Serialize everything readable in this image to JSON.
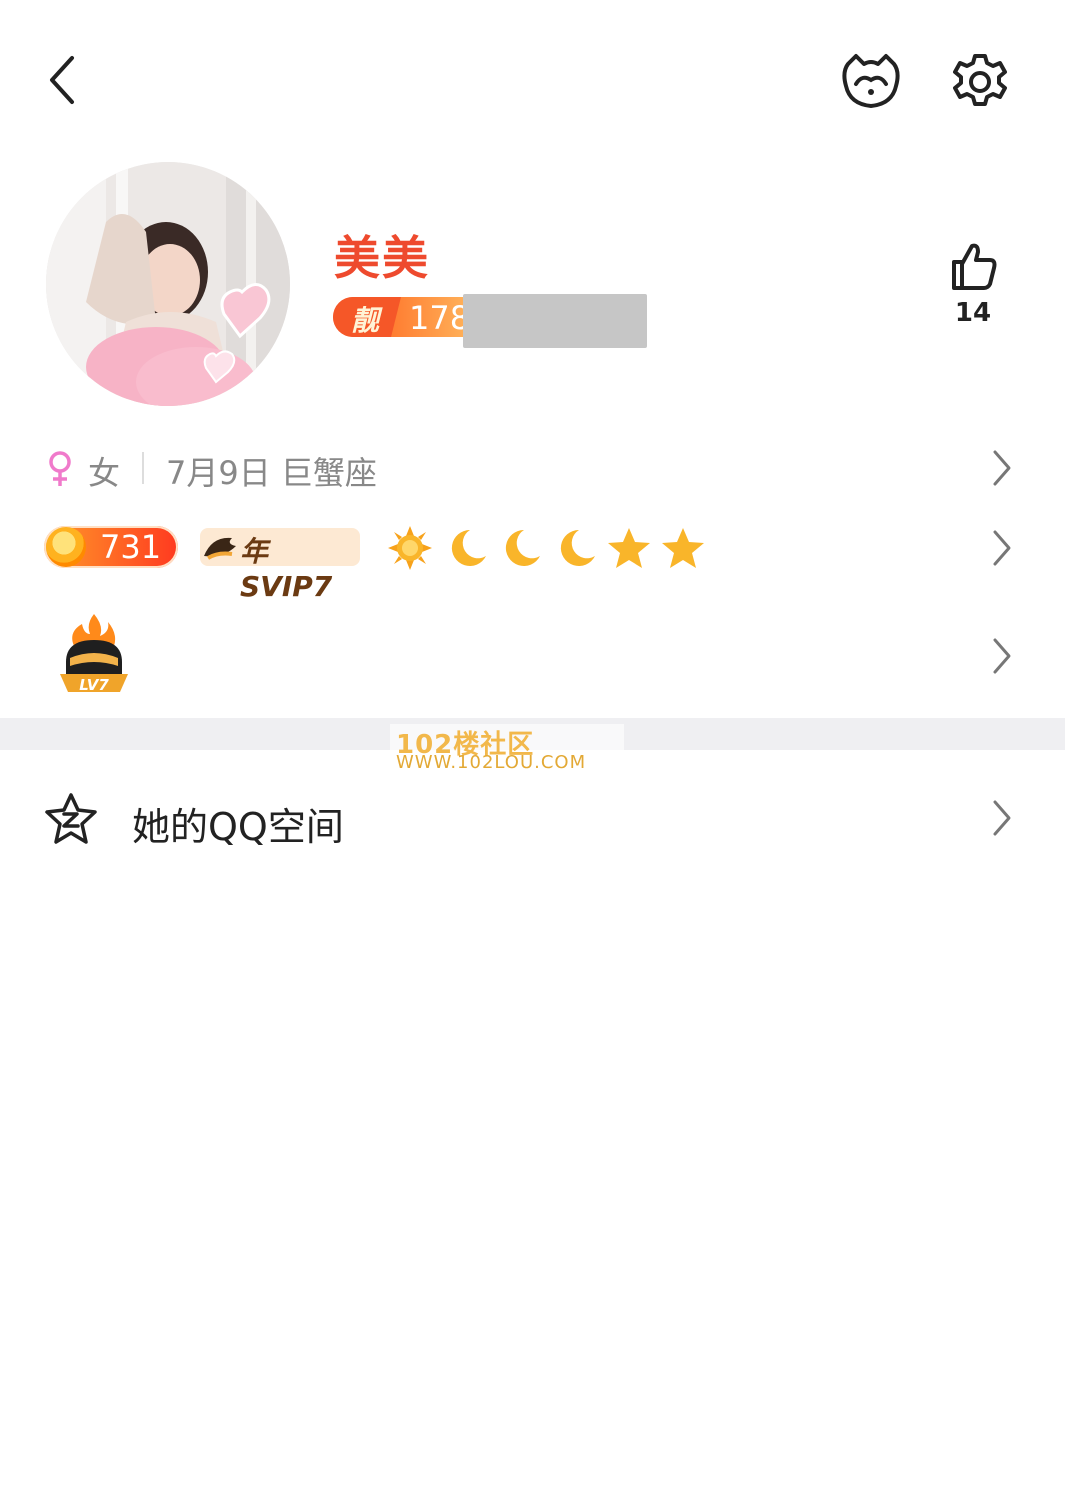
{
  "header": {
    "back_icon": "back-arrow-icon",
    "pet_icon": "pet-face-icon",
    "settings_icon": "gear-icon"
  },
  "profile": {
    "nickname": "美美",
    "pretty_number_tag": "靓",
    "pretty_number_visible": "178",
    "likes": "14",
    "accent_color": "#ee4a2e"
  },
  "info": {
    "gender_symbol": "♀",
    "gender": "女",
    "birthday_and_sign": "7月9日 巨蟹座"
  },
  "levels": {
    "qq_level": "731",
    "svip_label": "年SVIP7",
    "level_icons": [
      "sun-icon",
      "moon-icon",
      "moon-icon",
      "moon-icon",
      "star-icon",
      "star-icon"
    ]
  },
  "game": {
    "badge_label": "LV7"
  },
  "watermark": {
    "title": "102楼社区",
    "url": "WWW.102LOU.COM"
  },
  "qzone": {
    "label": "她的QQ空间"
  }
}
